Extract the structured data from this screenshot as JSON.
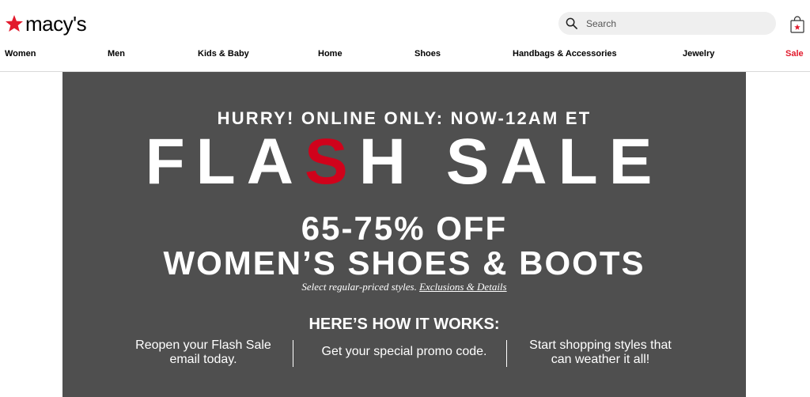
{
  "header": {
    "logo_text": "macy's",
    "search": {
      "placeholder": "Search"
    },
    "icons": {
      "logo": "star-icon",
      "search": "search-icon",
      "bag": "shopping-bag-icon"
    }
  },
  "nav": {
    "items": [
      {
        "label": "Women"
      },
      {
        "label": "Men"
      },
      {
        "label": "Kids & Baby"
      },
      {
        "label": "Home"
      },
      {
        "label": "Shoes"
      },
      {
        "label": "Handbags & Accessories"
      },
      {
        "label": "Jewelry"
      },
      {
        "label": "Sale"
      }
    ]
  },
  "banner": {
    "kicker": "HURRY! ONLINE ONLY: NOW-12AM ET",
    "headline_pre": "FLA",
    "headline_highlight": "S",
    "headline_post": "H SALE",
    "offer_line1": "65-75% OFF",
    "offer_line2": "WOMEN’S SHOES & BOOTS",
    "fine_print": "Select regular-priced styles.",
    "details_link": "Exclusions & Details",
    "how_title": "HERE’S HOW IT WORKS:",
    "steps": [
      {
        "line1": "Reopen your Flash Sale",
        "line2": "email today."
      },
      {
        "line1": "Get your special promo code.",
        "line2": ""
      },
      {
        "line1": "Start shopping styles that",
        "line2": "can weather it all!"
      }
    ]
  },
  "colors": {
    "brand_red": "#e21a2c",
    "banner_bg": "#4f4f4f",
    "headline_red": "#d0021b"
  }
}
